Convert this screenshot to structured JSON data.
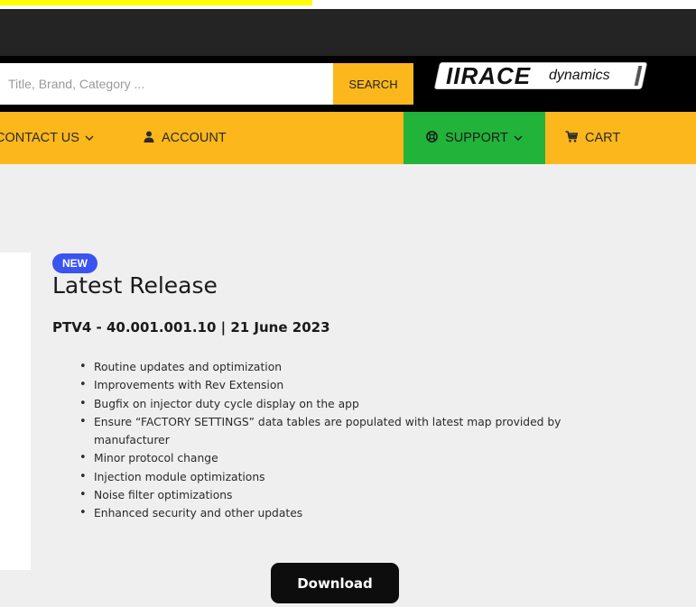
{
  "search": {
    "placeholder": "Title, Brand, Category ...",
    "button_label": "SEARCH"
  },
  "logo": {
    "race_text": "IIRACE",
    "dynamics_text": "dynamics"
  },
  "nav": {
    "contact_label": "CONTACT US",
    "account_label": "ACCOUNT",
    "support_label": "SUPPORT",
    "cart_label": "CART",
    "icons": {
      "account": "user-icon",
      "support": "lifebuoy-icon",
      "cart": "cart-icon",
      "dropdown": "chevron-down-icon"
    }
  },
  "colors": {
    "nav_bg": "#fbb71c",
    "support_bg": "#22b33a",
    "badge_bg": "#3b53f0",
    "topbar_bg": "#242424",
    "download_bg": "#0d0d0d"
  },
  "release": {
    "badge": "NEW",
    "title": "Latest Release",
    "version_line": "PTV4 - 40.001.001.10 | 21 June 2023",
    "notes": [
      "Routine updates and optimization",
      "Improvements with Rev Extension",
      "Bugfix on injector duty cycle display on the app",
      "Ensure “FACTORY SETTINGS” data tables are populated with latest map provided by manufacturer",
      "Minor protocol change",
      "Injection module optimizations",
      "Noise filter optimizations",
      "Enhanced security and other updates"
    ],
    "download_label": "Download"
  }
}
